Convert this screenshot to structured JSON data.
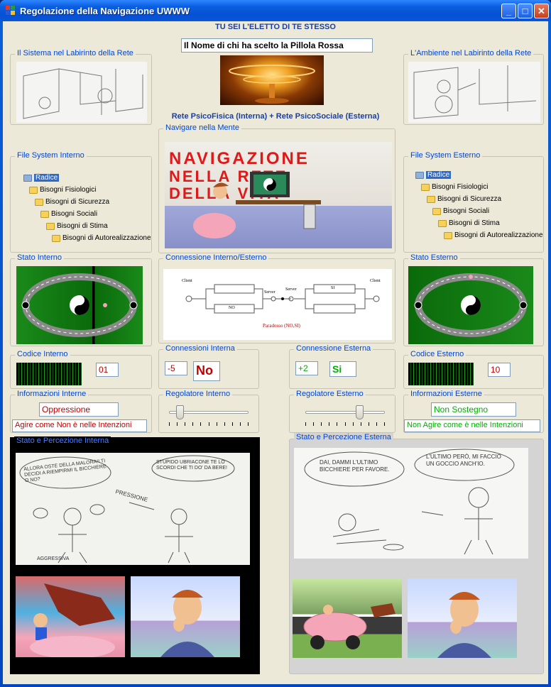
{
  "window": {
    "title": "Regolazione della Navigazione UWWW"
  },
  "header": {
    "motto": "TU SEI L'ELETTO DI TE STESSO",
    "name_field": "Il Nome di chi  ha scelto la Pillola Rossa",
    "subtitle": "Rete PsicoFisica (Interna) + Rete PsicoSociale (Esterna)"
  },
  "groups": {
    "sistema": "Il Sistema nel Labirinto della Rete",
    "ambiente": "L'Ambiente nel Labirinto della Rete",
    "navigare": "Navigare nella Mente",
    "fs_interno": "File System Interno",
    "fs_esterno": "File System Esterno",
    "stato_interno": "Stato  Interno",
    "stato_esterno": "Stato Esterno",
    "connessione": "Connessione Interno/Esterno",
    "codice_interno": "Codice Interno",
    "codice_esterno": "Codice Esterno",
    "connessioni_interna": "Connessioni Interna",
    "connessione_esterna": "Connessione Esterna",
    "info_interne": "Informazioni Interne",
    "info_esterne": "Informazioni Esterne",
    "regolatore_interno": "Regolatore Interno",
    "regolatore_esterno": "Regolatore Esterno",
    "percezione_interna": "Stato e Percezione Interna",
    "percezione_esterna": "Stato e Percezione Esterna"
  },
  "tree": {
    "items": [
      "Radice",
      "Bisogni Fisiologici",
      "Bisogni di Sicurezza",
      "Bisogni Sociali",
      "Bisogni di Stima",
      "Bisogni di Autorealizzazione"
    ]
  },
  "nav_banner": {
    "line1": "NAVIGAZIONE",
    "line2": "NELLA RETE",
    "line3": "DELLA VITA"
  },
  "diagram": {
    "client_left": "Client",
    "server_left": "Server",
    "server_right": "Server",
    "client_right": "Client",
    "box_no": "NO",
    "box_si": "SI",
    "caption": "Paradosso (NO,SI)"
  },
  "values": {
    "codice_interno": "01",
    "codice_esterno": "10",
    "conn_interna_num": "-5",
    "conn_interna_text": "No",
    "conn_esterna_num": "+2",
    "conn_esterna_text": "Si",
    "info_interne_value": "Oppressione",
    "info_interne_msg": "Agire come Non è nelle Intenzioni",
    "info_esterne_value": "Non Sostegno",
    "info_esterne_msg": "Non Agire come è nelle Intenzioni",
    "regolatore_interno_level": 0.1,
    "regolatore_esterno_level": 0.7
  },
  "comics": {
    "interna_speech1": "ALLORA OSTE DELLA MALORA!! TI DECIDI A RIEMPIRMI IL BICCHIERE O NO?",
    "interna_speech2": "STUPIDO UBRIACONE TE LO SCORDI CHE TI DO' DA BERE!",
    "interna_label1": "PRESSIONE",
    "interna_label2": "AGGRESSIVA",
    "esterna_speech1": "DAI, DAMMI L'ULTIMO BICCHIERE PER FAVORE.",
    "esterna_speech2": "L'ULTIMO PERÒ, MI FACCIO UN GOCCIO ANCH'IO."
  },
  "colors": {
    "title_blue": "#0a5fe0",
    "label_blue": "#0046d5",
    "red_text": "#c00000",
    "green_text": "#00b000",
    "green_panel": "#1a7a1a"
  }
}
